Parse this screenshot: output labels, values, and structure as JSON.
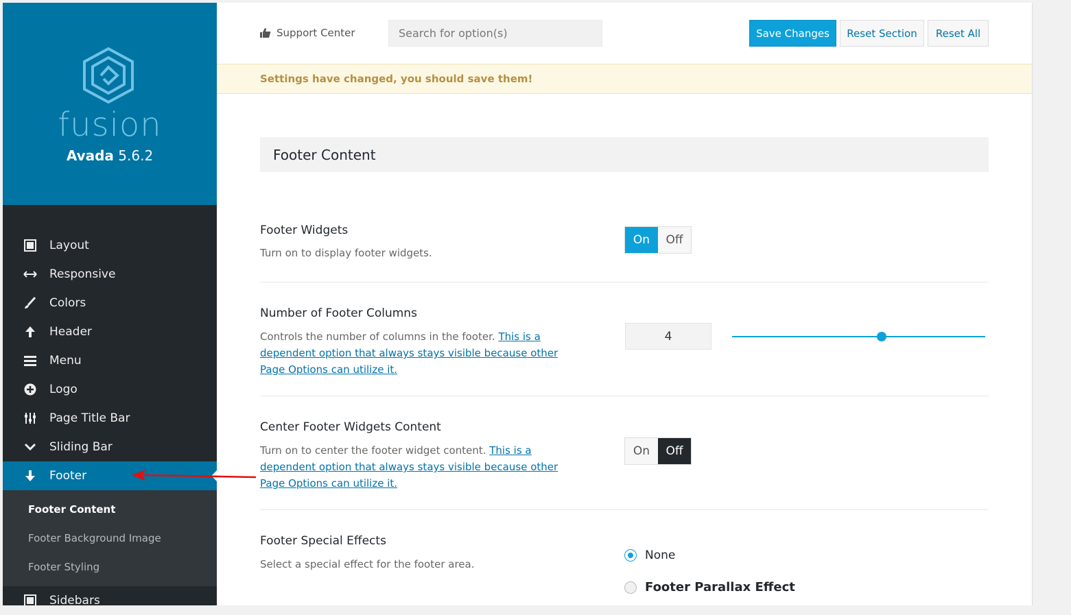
{
  "brand": {
    "wordmark": "fusion",
    "product": "Avada",
    "version": "5.6.2"
  },
  "colors": {
    "brand_blue": "#0074a2",
    "accent": "#0ea1d9",
    "sidebar_bg": "#23282d",
    "notice_text": "#b49045"
  },
  "sidebar": {
    "items": [
      {
        "label": "Layout",
        "icon": "layout-icon"
      },
      {
        "label": "Responsive",
        "icon": "arrows-horizontal-icon"
      },
      {
        "label": "Colors",
        "icon": "brush-icon"
      },
      {
        "label": "Header",
        "icon": "arrow-up-icon"
      },
      {
        "label": "Menu",
        "icon": "hamburger-icon"
      },
      {
        "label": "Logo",
        "icon": "plus-circle-icon"
      },
      {
        "label": "Page Title Bar",
        "icon": "sliders-icon"
      },
      {
        "label": "Sliding Bar",
        "icon": "chevron-down-icon"
      },
      {
        "label": "Footer",
        "icon": "arrow-down-icon"
      },
      {
        "label": "Sidebars",
        "icon": "sidebar-layout-icon"
      }
    ],
    "active": "Footer",
    "footer_sub": [
      {
        "label": "Footer Content"
      },
      {
        "label": "Footer Background Image"
      },
      {
        "label": "Footer Styling"
      }
    ]
  },
  "topbar": {
    "support_label": "Support Center",
    "search_placeholder": "Search for option(s)",
    "save_label": "Save Changes",
    "reset_section_label": "Reset Section",
    "reset_all_label": "Reset All"
  },
  "notice": {
    "text": "Settings have changed, you should save them!"
  },
  "section": {
    "title": "Footer Content"
  },
  "options": {
    "footer_widgets": {
      "title": "Footer Widgets",
      "desc": "Turn on to display footer widgets.",
      "on_label": "On",
      "off_label": "Off",
      "value": "On"
    },
    "footer_columns": {
      "title": "Number of Footer Columns",
      "desc": "Controls the number of columns in the footer. ",
      "link": "This is a dependent option that always stays visible because other Page Options can utilize it.",
      "value": "4",
      "slider_fraction": 0.59
    },
    "center_widgets": {
      "title": "Center Footer Widgets Content",
      "desc": "Turn on to center the footer widget content. ",
      "link": "This is a dependent option that always stays visible because other Page Options can utilize it.",
      "on_label": "On",
      "off_label": "Off",
      "value": "Off"
    },
    "special_effects": {
      "title": "Footer Special Effects",
      "desc": "Select a special effect for the footer area.",
      "choices": [
        "None",
        "Footer Parallax Effect"
      ],
      "selected": "None"
    }
  }
}
